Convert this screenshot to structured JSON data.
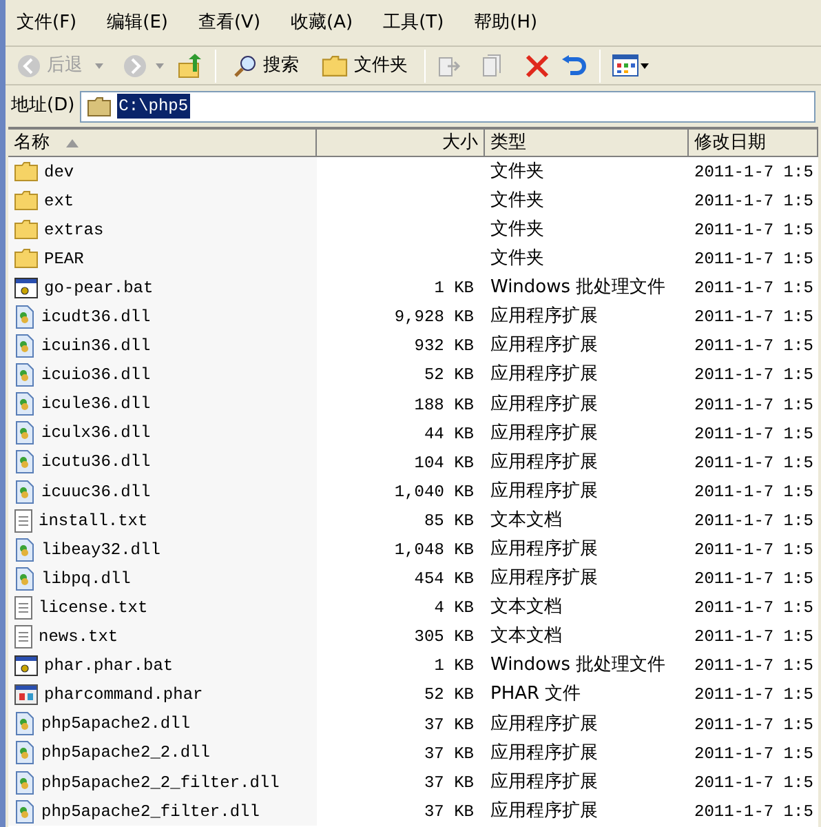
{
  "menu": [
    "文件(F)",
    "编辑(E)",
    "查看(V)",
    "收藏(A)",
    "工具(T)",
    "帮助(H)"
  ],
  "toolbar": {
    "back": {
      "label": "后退",
      "disabled": true
    },
    "search": "搜索",
    "folders": "文件夹"
  },
  "address": {
    "label": "地址(D)",
    "value": "C:\\php5"
  },
  "columns": [
    {
      "label": "名称",
      "sorted": true
    },
    {
      "label": "大小",
      "sorted": false
    },
    {
      "label": "类型",
      "sorted": false
    },
    {
      "label": "修改日期",
      "sorted": false
    }
  ],
  "rows": [
    {
      "kind": "folder",
      "name": "dev",
      "size": "",
      "type": "文件夹",
      "date": "2011-1-7 1:5"
    },
    {
      "kind": "folder",
      "name": "ext",
      "size": "",
      "type": "文件夹",
      "date": "2011-1-7 1:5"
    },
    {
      "kind": "folder",
      "name": "extras",
      "size": "",
      "type": "文件夹",
      "date": "2011-1-7 1:5"
    },
    {
      "kind": "folder",
      "name": "PEAR",
      "size": "",
      "type": "文件夹",
      "date": "2011-1-7 1:5"
    },
    {
      "kind": "bat",
      "name": "go-pear.bat",
      "size": "1 KB",
      "type": "Windows 批处理文件",
      "date": "2011-1-7 1:5"
    },
    {
      "kind": "dll",
      "name": "icudt36.dll",
      "size": "9,928 KB",
      "type": "应用程序扩展",
      "date": "2011-1-7 1:5"
    },
    {
      "kind": "dll",
      "name": "icuin36.dll",
      "size": "932 KB",
      "type": "应用程序扩展",
      "date": "2011-1-7 1:5"
    },
    {
      "kind": "dll",
      "name": "icuio36.dll",
      "size": "52 KB",
      "type": "应用程序扩展",
      "date": "2011-1-7 1:5"
    },
    {
      "kind": "dll",
      "name": "icule36.dll",
      "size": "188 KB",
      "type": "应用程序扩展",
      "date": "2011-1-7 1:5"
    },
    {
      "kind": "dll",
      "name": "iculx36.dll",
      "size": "44 KB",
      "type": "应用程序扩展",
      "date": "2011-1-7 1:5"
    },
    {
      "kind": "dll",
      "name": "icutu36.dll",
      "size": "104 KB",
      "type": "应用程序扩展",
      "date": "2011-1-7 1:5"
    },
    {
      "kind": "dll",
      "name": "icuuc36.dll",
      "size": "1,040 KB",
      "type": "应用程序扩展",
      "date": "2011-1-7 1:5"
    },
    {
      "kind": "txt",
      "name": "install.txt",
      "size": "85 KB",
      "type": "文本文档",
      "date": "2011-1-7 1:5"
    },
    {
      "kind": "dll",
      "name": "libeay32.dll",
      "size": "1,048 KB",
      "type": "应用程序扩展",
      "date": "2011-1-7 1:5"
    },
    {
      "kind": "dll",
      "name": "libpq.dll",
      "size": "454 KB",
      "type": "应用程序扩展",
      "date": "2011-1-7 1:5"
    },
    {
      "kind": "txt",
      "name": "license.txt",
      "size": "4 KB",
      "type": "文本文档",
      "date": "2011-1-7 1:5"
    },
    {
      "kind": "txt",
      "name": "news.txt",
      "size": "305 KB",
      "type": "文本文档",
      "date": "2011-1-7 1:5"
    },
    {
      "kind": "bat",
      "name": "phar.phar.bat",
      "size": "1 KB",
      "type": "Windows 批处理文件",
      "date": "2011-1-7 1:5"
    },
    {
      "kind": "phar",
      "name": "pharcommand.phar",
      "size": "52 KB",
      "type": "PHAR 文件",
      "date": "2011-1-7 1:5"
    },
    {
      "kind": "dll",
      "name": "php5apache2.dll",
      "size": "37 KB",
      "type": "应用程序扩展",
      "date": "2011-1-7 1:5"
    },
    {
      "kind": "dll",
      "name": "php5apache2_2.dll",
      "size": "37 KB",
      "type": "应用程序扩展",
      "date": "2011-1-7 1:5"
    },
    {
      "kind": "dll",
      "name": "php5apache2_2_filter.dll",
      "size": "37 KB",
      "type": "应用程序扩展",
      "date": "2011-1-7 1:5"
    },
    {
      "kind": "dll",
      "name": "php5apache2_filter.dll",
      "size": "37 KB",
      "type": "应用程序扩展",
      "date": "2011-1-7 1:5"
    }
  ]
}
